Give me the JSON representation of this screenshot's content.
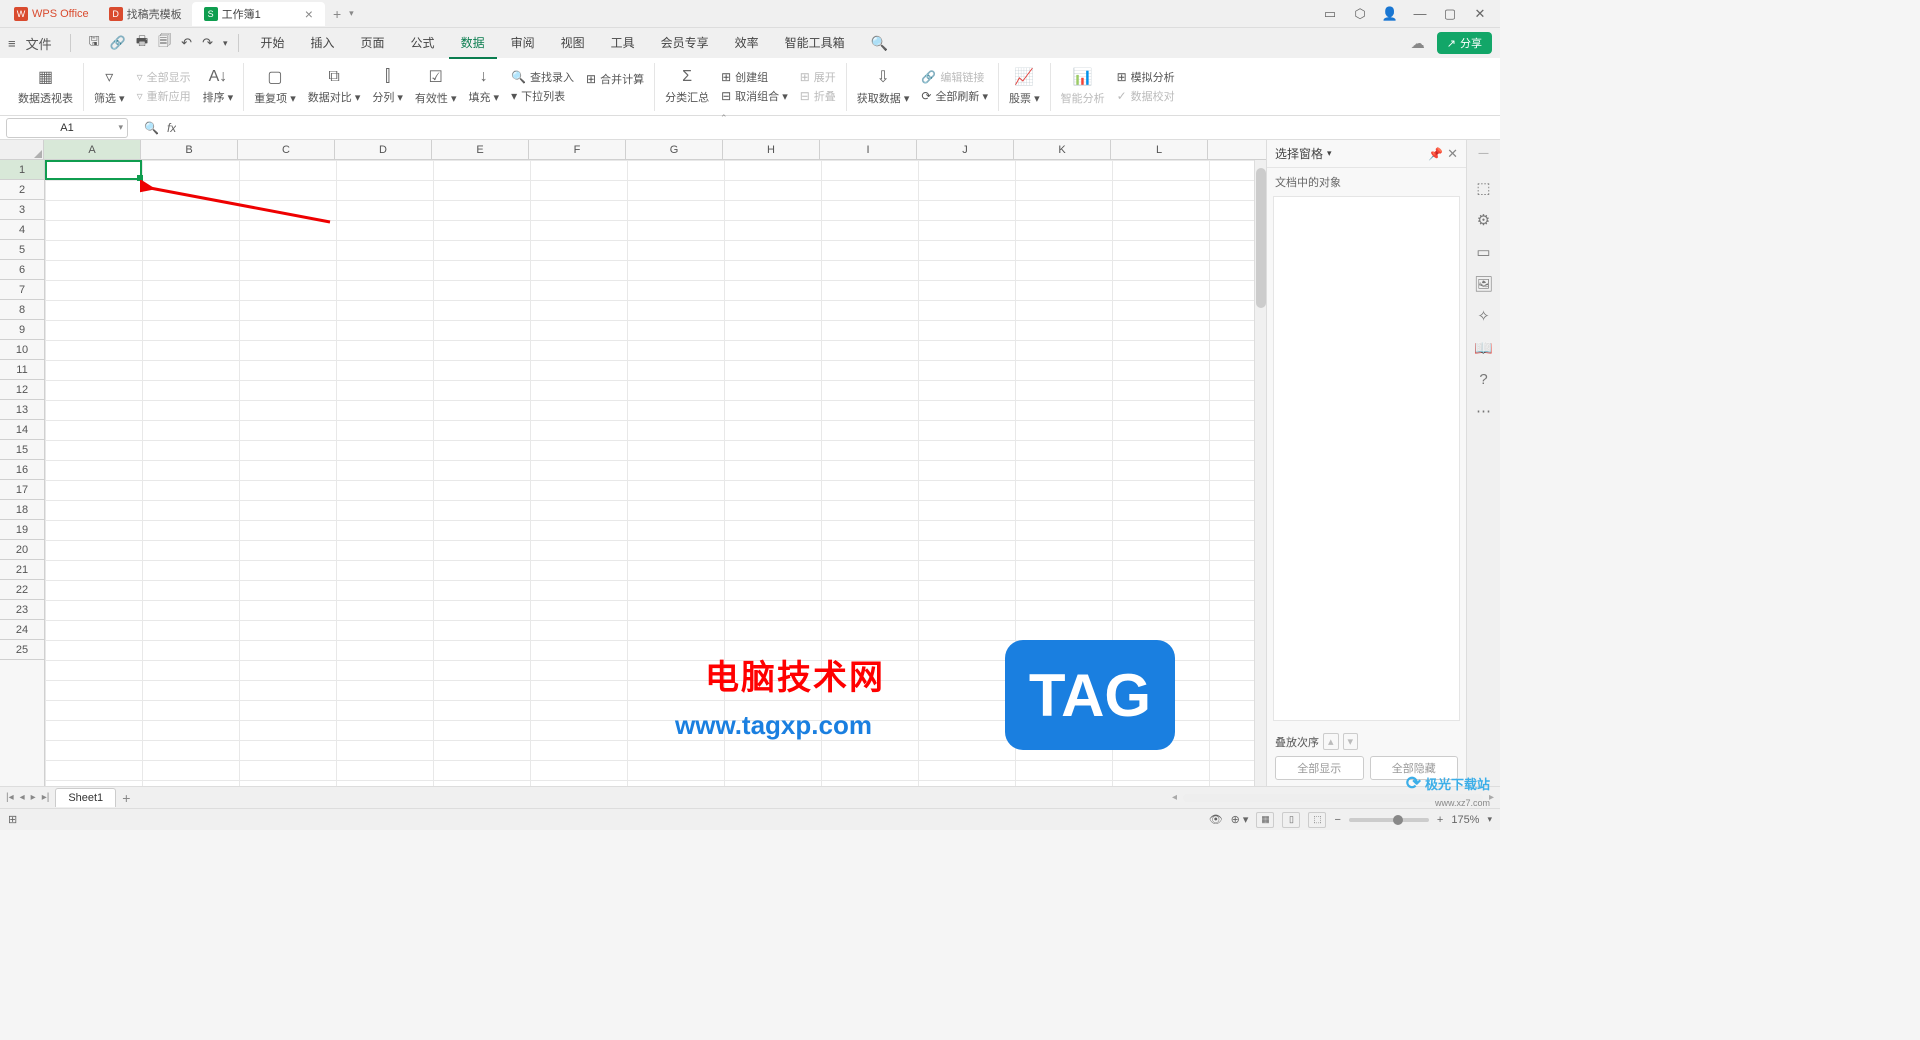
{
  "title_tabs": {
    "wps": "WPS Office",
    "template": "找稿壳模板",
    "doc": "工作簿1"
  },
  "menu": {
    "file": "文件",
    "tabs": [
      "开始",
      "插入",
      "页面",
      "公式",
      "数据",
      "审阅",
      "视图",
      "工具",
      "会员专享",
      "效率",
      "智能工具箱"
    ],
    "active_index": 4,
    "share": "分享"
  },
  "ribbon": {
    "pivot": "数据透视表",
    "filter": "筛选",
    "show_all": "全部显示",
    "reapply": "重新应用",
    "sort": "排序",
    "dup": "重复项",
    "compare": "数据对比",
    "split": "分列",
    "validity": "有效性",
    "fill": "填充",
    "findrec": "查找录入",
    "merge": "合并计算",
    "dropdown": "下拉列表",
    "subtotal": "分类汇总",
    "group": "创建组",
    "ungroup": "取消组合",
    "expand": "展开",
    "collapse": "折叠",
    "getdata": "获取数据",
    "editlink": "编辑链接",
    "refreshall": "全部刷新",
    "stock": "股票",
    "smart": "智能分析",
    "whatif": "模拟分析",
    "dataval": "数据校对"
  },
  "formula": {
    "cell": "A1",
    "fx": "fx"
  },
  "columns": [
    "A",
    "B",
    "C",
    "D",
    "E",
    "F",
    "G",
    "H",
    "I",
    "J",
    "K",
    "L"
  ],
  "rows": [
    "1",
    "2",
    "3",
    "4",
    "5",
    "6",
    "7",
    "8",
    "9",
    "10",
    "11",
    "12",
    "13",
    "14",
    "15",
    "16",
    "17",
    "18",
    "19",
    "20",
    "21",
    "22",
    "23",
    "24",
    "25"
  ],
  "rpanel": {
    "title": "选择窗格",
    "sub": "文档中的对象",
    "order": "叠放次序",
    "show_all": "全部显示",
    "hide_all": "全部隐藏"
  },
  "sheet": {
    "name": "Sheet1"
  },
  "status": {
    "zoom": "175%"
  },
  "overlay": {
    "text": "电脑技术网",
    "url": "www.tagxp.com",
    "tag": "TAG",
    "wm": "极光下载站",
    "wm2": "www.xz7.com"
  }
}
